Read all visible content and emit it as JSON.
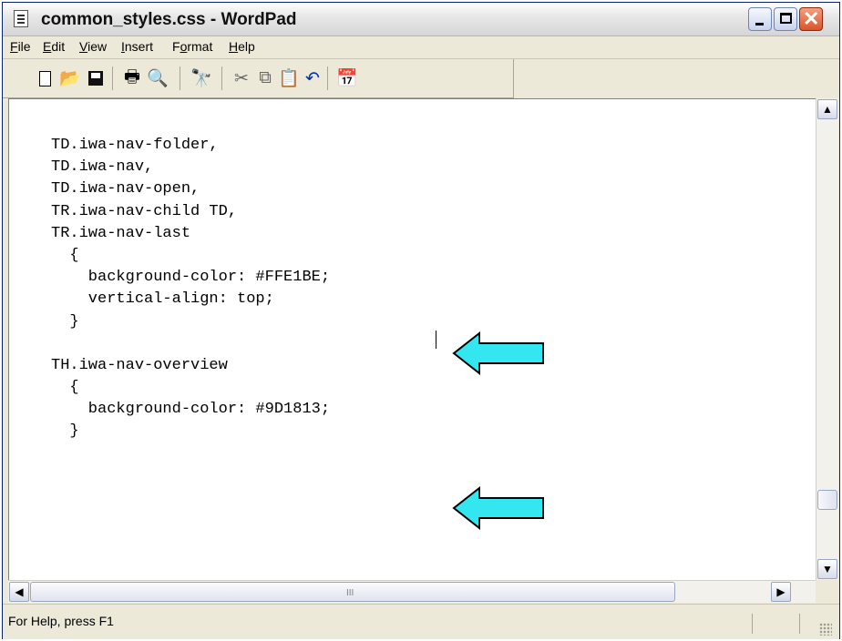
{
  "window": {
    "title": "common_styles.css - WordPad",
    "app_icon": "notepad-document-icon"
  },
  "menu": {
    "items": [
      {
        "label": "File",
        "mnemonic": "F"
      },
      {
        "label": "Edit",
        "mnemonic": "E"
      },
      {
        "label": "View",
        "mnemonic": "V"
      },
      {
        "label": "Insert",
        "mnemonic": "I"
      },
      {
        "label": "Format",
        "mnemonic": "o"
      },
      {
        "label": "Help",
        "mnemonic": "H"
      }
    ]
  },
  "toolbar": {
    "buttons": [
      {
        "name": "new-document",
        "icon": "new-document-icon"
      },
      {
        "name": "open",
        "icon": "open-folder-icon"
      },
      {
        "name": "save",
        "icon": "floppy-disk-icon"
      },
      {
        "name": "print",
        "icon": "printer-icon"
      },
      {
        "name": "print-preview",
        "icon": "print-preview-icon"
      },
      {
        "name": "find",
        "icon": "binoculars-icon"
      },
      {
        "name": "cut",
        "icon": "scissors-icon"
      },
      {
        "name": "copy",
        "icon": "copy-icon"
      },
      {
        "name": "paste",
        "icon": "clipboard-paste-icon"
      },
      {
        "name": "undo",
        "icon": "undo-arrow-icon"
      },
      {
        "name": "date-time",
        "icon": "calendar-clock-icon"
      }
    ]
  },
  "document": {
    "lines": [
      "TD.iwa-nav-folder,",
      "TD.iwa-nav,",
      "TD.iwa-nav-open,",
      "TR.iwa-nav-child TD,",
      "TR.iwa-nav-last",
      "  {",
      "    background-color: #FFE1BE;",
      "    vertical-align: top;",
      "  }",
      "",
      "TH.iwa-nav-overview",
      "  {",
      "    background-color: #9D1813;",
      "  }"
    ],
    "annotations": [
      {
        "icon": "left-arrow-callout-icon",
        "points_to_line": 7,
        "color": "#33e6f0"
      },
      {
        "icon": "left-arrow-callout-icon",
        "points_to_line": 13,
        "color": "#33e6f0"
      }
    ]
  },
  "scrollbars": {
    "grip_glyph": "III"
  },
  "status": {
    "text": "For Help, press F1"
  },
  "colors": {
    "titlebar": "#dcdcdc",
    "chrome": "#ece9d8",
    "editor_bg": "#ffffff",
    "close_button": "#d8562a",
    "arrow_fill": "#33e6f0"
  }
}
